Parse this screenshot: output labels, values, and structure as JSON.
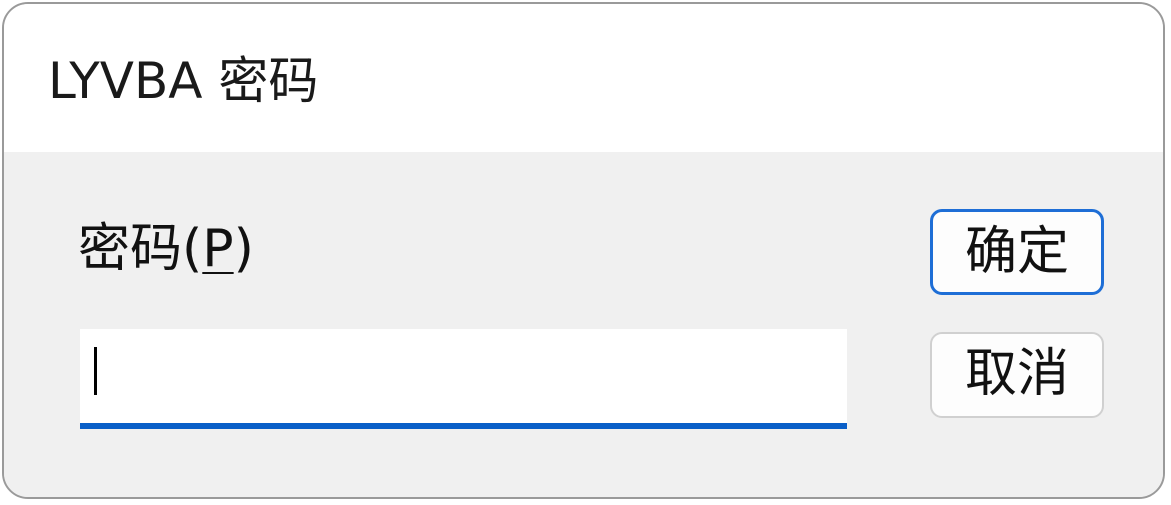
{
  "dialog": {
    "title": "LYVBA 密码"
  },
  "password": {
    "label": "密码(",
    "mnemonic": "P",
    "label_close": ")",
    "value": ""
  },
  "buttons": {
    "ok_label": "确定",
    "cancel_label": "取消"
  },
  "colors": {
    "focus_accent": "#0a5fc8",
    "dialog_background": "#f0f0f0"
  }
}
